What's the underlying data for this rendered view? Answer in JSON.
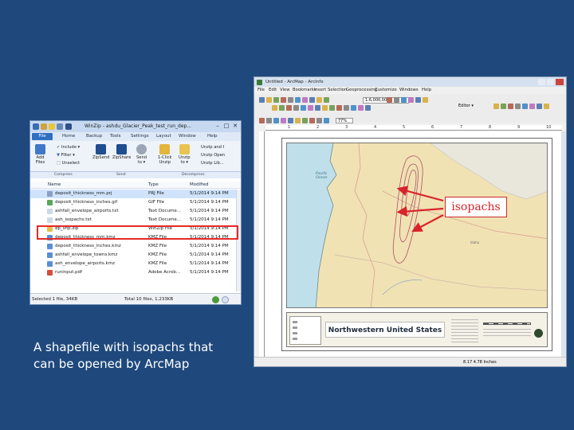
{
  "caption": "A shapefile with isopachs that can be opened by ArcMap",
  "callout": "isopachs",
  "colors": {
    "background": "#1f497d",
    "highlight": "#e52a2a",
    "callout": "#d9232a",
    "selection": "#cfe3fb"
  },
  "winzip": {
    "title": "WinZip - ashdu_Glacier_Peak_test_run_dep...",
    "window_controls": [
      "–",
      "□",
      "✕"
    ],
    "file_tab": "File",
    "tabs": [
      "Home",
      "Backup",
      "Tools",
      "Settings",
      "Layout",
      "Window",
      "Help"
    ],
    "ribbon": {
      "add_files": "Add\nFiles",
      "include": "Include ▾",
      "filter": "Filter ▾",
      "unselect": "Unselect",
      "zip_send": "ZipSend",
      "zip_share": "ZipShare",
      "send_to": "Send\nto ▾",
      "one_click_unzip": "1-Click\nUnzip",
      "unzip_options": "Unzip\nto ▾",
      "unzip_and_install": "Unzip and I",
      "unzip_and_open": "Unzip Open",
      "unzip_and_share": "Unzip Lib..."
    },
    "groups": [
      "Compress",
      "Send",
      "Decompress"
    ],
    "columns": [
      "Name",
      "Type",
      "Modified"
    ],
    "files": [
      {
        "name": "deposit_thickness_mm.prj",
        "type": "PRJ File",
        "modified": "5/1/2014 9:14 PM",
        "color": "#8aa0c4",
        "selected": true
      },
      {
        "name": "deposit_thickness_inches.gif",
        "type": "GIF File",
        "modified": "5/1/2014 9:14 PM",
        "color": "#58a85c",
        "selected": false
      },
      {
        "name": "ashfall_envelope_airports.txt",
        "type": "Text Docume...",
        "modified": "5/1/2014 9:14 PM",
        "color": "#cfd8e6",
        "selected": false
      },
      {
        "name": "ash_isopachs.txt",
        "type": "Text Docume...",
        "modified": "5/1/2014 9:14 PM",
        "color": "#cfd8e6",
        "selected": false
      },
      {
        "name": "dp_shp.zip",
        "type": "WinZip File",
        "modified": "5/1/2014 9:14 PM",
        "color": "#e3c14a",
        "selected": false
      },
      {
        "name": "deposit_thickness_mm.kmz",
        "type": "KMZ File",
        "modified": "5/1/2014 9:14 PM",
        "color": "#5a8fd6",
        "selected": false
      },
      {
        "name": "deposit_thickness_inches.kmz",
        "type": "KMZ File",
        "modified": "5/1/2014 9:14 PM",
        "color": "#5a8fd6",
        "selected": false
      },
      {
        "name": "ashfall_envelope_towns.kmz",
        "type": "KMZ File",
        "modified": "5/1/2014 9:14 PM",
        "color": "#5a8fd6",
        "selected": false
      },
      {
        "name": "ash_envelope_airports.kmz",
        "type": "KMZ File",
        "modified": "5/1/2014 9:14 PM",
        "color": "#5a8fd6",
        "selected": false
      },
      {
        "name": "runinput.pdf",
        "type": "Adobe Acrob...",
        "modified": "5/1/2014 9:14 PM",
        "color": "#d94b3b",
        "selected": false
      }
    ],
    "status_left": "Selected 1 file, 34KB",
    "status_right": "Total 10 files, 1,233KB"
  },
  "arcmap": {
    "title": "Untitled - ArcMap - ArcInfo",
    "menus": [
      "File",
      "Edit",
      "View",
      "Bookmarks",
      "Insert",
      "Selection",
      "Geoprocessing",
      "Customize",
      "Windows",
      "Help"
    ],
    "scale": "1:6,000,000",
    "zoom": "77%",
    "editor_label": "Editor ▾",
    "ruler_ticks": [
      "1",
      "2",
      "3",
      "4",
      "5",
      "6",
      "7",
      "8",
      "9",
      "10"
    ],
    "map_labels": {
      "ocean": "Pacific\nOcean",
      "place": "Idaho"
    },
    "map_title": "Northwestern United States",
    "status": "8.17  4.78 Inches"
  }
}
